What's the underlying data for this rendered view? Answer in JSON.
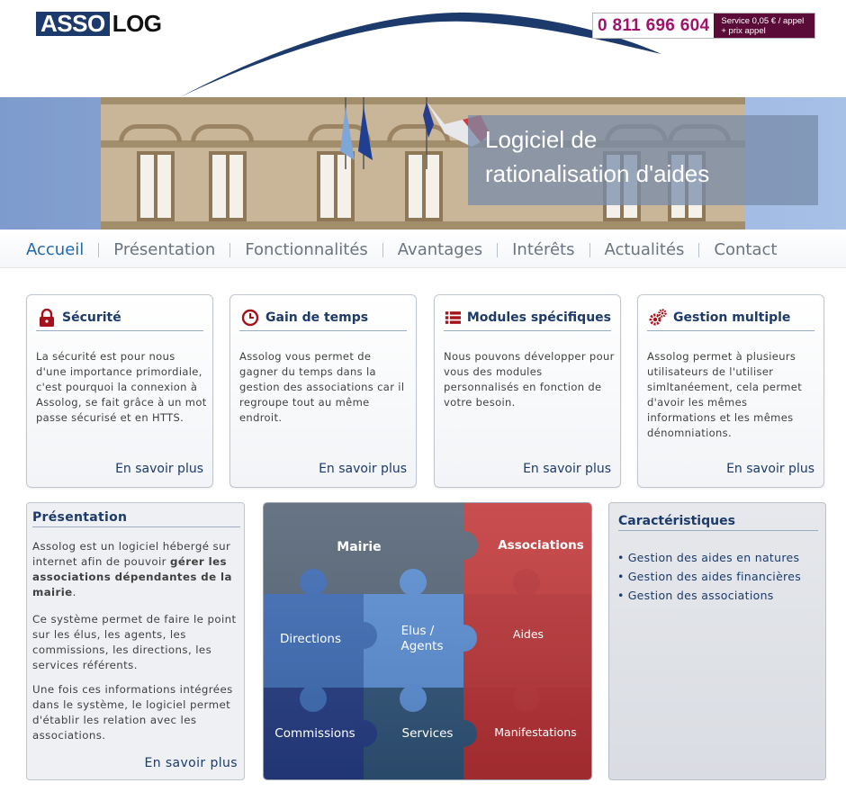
{
  "header": {
    "logo_left": "ASSO",
    "logo_right": "LOG",
    "phone_number": "0 811 696 604",
    "phone_tag_line1": "Service 0,05 € / appel",
    "phone_tag_line2": "+ prix appel"
  },
  "banner": {
    "title_line1": "Logiciel de",
    "title_line2": "rationalisation d'aides"
  },
  "nav": {
    "items": [
      "Accueil",
      "Présentation",
      "Fonctionnalités",
      "Avantages",
      "Intérêts",
      "Actualités",
      "Contact"
    ],
    "active": "Accueil"
  },
  "cards": [
    {
      "icon": "lock-icon",
      "title": "Sécurité",
      "body": "La sécurité est pour nous d'une importance primordiale, c'est pourquoi la connexion à Assolog, se fait grâce à un mot passe sécurisé et en HTTS.",
      "more": "En savoir plus"
    },
    {
      "icon": "clock-icon",
      "title": "Gain de temps",
      "body": "Assolog vous permet de gagner du temps dans la gestion des associations car il regroupe tout au même endroit.",
      "more": "En savoir plus"
    },
    {
      "icon": "list-icon",
      "title": "Modules spécifiques",
      "body": "Nous pouvons développer pour vous des modules personnalisés en fonction de votre besoin.",
      "more": "En savoir plus"
    },
    {
      "icon": "gears-icon",
      "title": "Gestion multiple",
      "body": "Assolog permet à plusieurs utilisateurs de l'utiliser simltanéement, cela permet d'avoir les mêmes informations et les mêmes dénomniations.",
      "more": "En savoir plus"
    }
  ],
  "presentation": {
    "title": "Présentation",
    "p1_before": "Assolog est un logiciel hébergé sur internet afin de pouvoir ",
    "p1_bold": "gérer les associations dépendantes de la mairie",
    "p1_after": ".",
    "p2": "Ce système permet de faire le point sur les élus, les agents, les commissions, les directions, les services référents.",
    "p3": "Une fois ces informations intégrées dans le système, le logiciel permet d'établir les relation avec les associations.",
    "more": "En savoir plus"
  },
  "puzzle": {
    "pieces": {
      "mairie": "Mairie",
      "associations": "Associations",
      "directions": "Directions",
      "elus_line1": "Elus /",
      "elus_line2": "Agents",
      "aides": "Aides",
      "commissions": "Commissions",
      "services": "Services",
      "manifestations": "Manifestations"
    },
    "colors": {
      "mairie": "#566577",
      "associations": "#c23a3c",
      "directions": "#3d6cb5",
      "elus": "#5b8ed4",
      "aides": "#b93538",
      "commissions": "#253c84",
      "services": "#2f5378",
      "manifestations": "#b53034"
    }
  },
  "caracteristiques": {
    "title": "Caractéristiques",
    "items": [
      "Gestion des aides en natures",
      "Gestion des aides financières",
      "Gestion des associations"
    ]
  },
  "colors": {
    "brand_navy": "#1d3a6c",
    "phone_magenta": "#a0126b",
    "nav_active": "#1f68ad",
    "heading": "#1c3b6a"
  }
}
